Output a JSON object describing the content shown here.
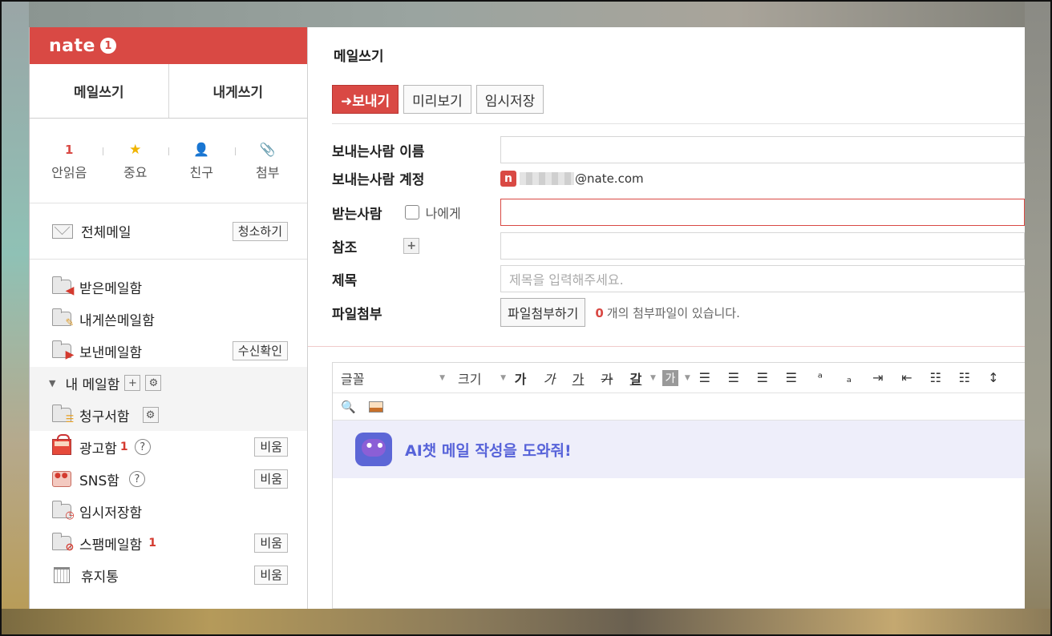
{
  "brand": {
    "logo": "nate",
    "badge": "1"
  },
  "compose": {
    "write": "메일쓰기",
    "self_write": "내게쓰기"
  },
  "quick": [
    {
      "top": "1",
      "label": "안읽음"
    },
    {
      "top": "★",
      "label": "중요"
    },
    {
      "top": "👤",
      "label": "친구"
    },
    {
      "top": "📎",
      "label": "첨부"
    }
  ],
  "allmail": {
    "label": "전체메일",
    "button": "청소하기"
  },
  "folders": {
    "inbox": "받은메일함",
    "self_sent": "내게쓴메일함",
    "sent": {
      "label": "보낸메일함",
      "button": "수신확인"
    },
    "my_mailbox": "내 메일함",
    "bills": "청구서함",
    "ads": {
      "label": "광고함",
      "count": "1",
      "button": "비움"
    },
    "sns": {
      "label": "SNS함",
      "button": "비움"
    },
    "drafts": "임시저장함",
    "spam": {
      "label": "스팸메일함",
      "count": "1",
      "button": "비움"
    },
    "trash": {
      "label": "휴지통",
      "button": "비움"
    }
  },
  "main": {
    "title": "메일쓰기",
    "toolbar": {
      "send": "➜보내기",
      "preview": "미리보기",
      "save": "임시저장"
    },
    "form": {
      "sender_name": "보내는사람 이름",
      "sender_account": "보내는사람 계정",
      "account_suffix": "@nate.com",
      "recipient": "받는사람",
      "to_me": "나에게",
      "cc": "참조",
      "subject": "제목",
      "subject_placeholder": "제목을 입력해주세요.",
      "attachment": "파일첨부",
      "attach_button": "파일첨부하기",
      "attach_count": "0",
      "attach_info": "개의 첨부파일이 있습니다."
    },
    "editor": {
      "font": "글꼴",
      "size": "크기",
      "glyphs": [
        "가",
        "가",
        "가",
        "가",
        "가"
      ],
      "ai_text": "AI챗 메일 작성을 도와줘!"
    }
  },
  "colors": {
    "brand_red": "#d94944",
    "ai_purple": "#5763d9"
  }
}
